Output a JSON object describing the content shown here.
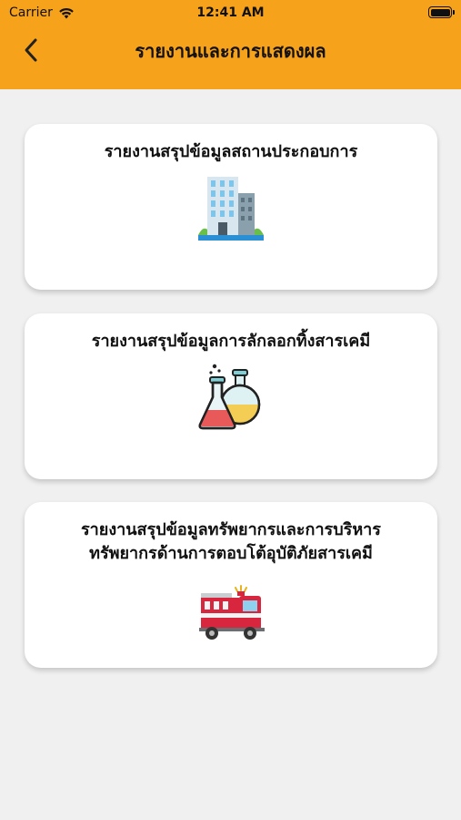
{
  "status_bar": {
    "carrier": "Carrier",
    "time": "12:41 AM"
  },
  "header": {
    "title": "รายงานและการแสดงผล",
    "back_icon": "chevron-left-icon",
    "color": "#f7a21b"
  },
  "cards": [
    {
      "title": "รายงานสรุปข้อมูลสถานประกอบการ",
      "icon": "building-icon"
    },
    {
      "title": "รายงานสรุปข้อมูลการลักลอกทิ้งสารเคมี",
      "icon": "chemical-flasks-icon"
    },
    {
      "title_line1": "รายงานสรุปข้อมูลทรัพยากรและการบริหาร",
      "title_line2": "ทรัพยากรด้านการตอบโต้อุบัติภัยสารเคมี",
      "icon": "fire-truck-icon"
    }
  ]
}
